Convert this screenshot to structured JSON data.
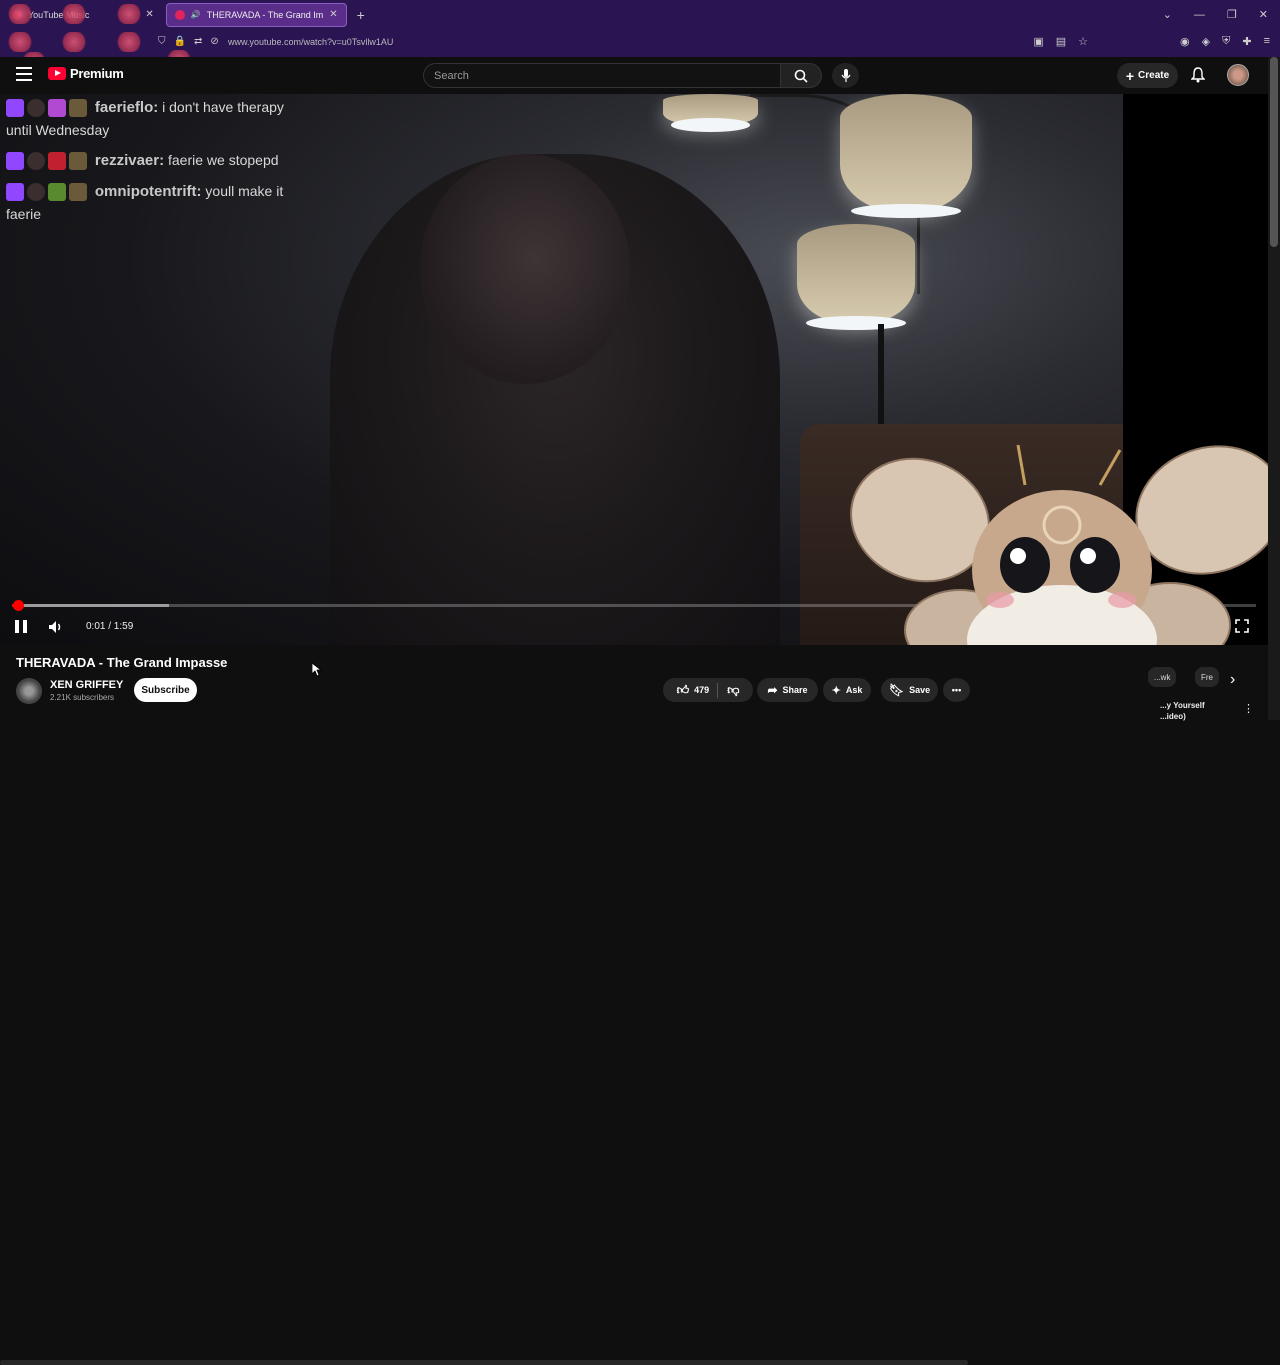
{
  "browser": {
    "tabs": [
      {
        "label": "YouTube Music",
        "active": false
      },
      {
        "label": "THERAVADA - The Grand Im",
        "active": true
      }
    ],
    "url": "www.youtube.com/watch?v=u0Tsvllw1AU"
  },
  "header": {
    "logo_text": "Premium",
    "search_placeholder": "Search",
    "create_label": "Create"
  },
  "chat": [
    {
      "user": "faerieflo:",
      "message": "i don't have therapy until Wednesday"
    },
    {
      "user": "rezzivaer:",
      "message": "faerie we stopepd"
    },
    {
      "user": "omnipotentrift:",
      "message": "youll make it faerie"
    }
  ],
  "player": {
    "time": "0:01 / 1:59",
    "progress_played_fraction": 0.005,
    "progress_buffered_fraction": 0.126
  },
  "video": {
    "title": "THERAVADA - The Grand Impasse",
    "channel": "XEN GRIFFEY",
    "subscribers": "2.21K subscribers",
    "subscribe_label": "Subscribe",
    "likes": "479",
    "share_label": "Share",
    "ask_label": "Ask",
    "save_label": "Save"
  },
  "recommendations": {
    "chips": [
      "...wk",
      "Fre"
    ],
    "item_title": "...y Yourself ...ideo)"
  },
  "colors": {
    "browser_bg": "#2a1452",
    "yt_red": "#ff0033",
    "page_bg": "#0f0f0f",
    "twitch_purple": "#9146ff"
  }
}
